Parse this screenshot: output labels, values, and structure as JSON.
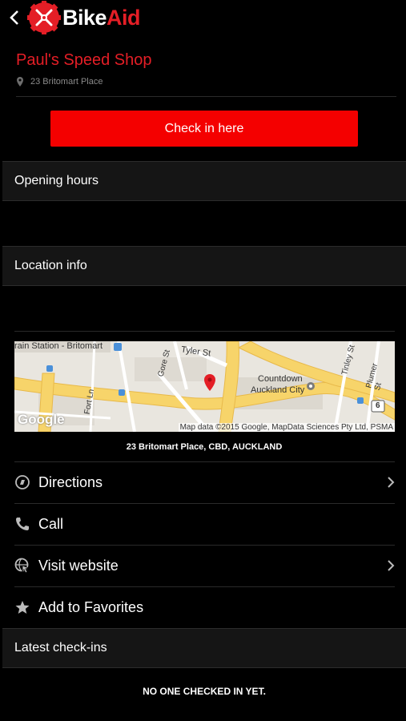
{
  "app": {
    "brand_part1": "Bike",
    "brand_part2": "Aid"
  },
  "shop": {
    "name": "Paul's Speed Shop",
    "address": "23 Britomart Place"
  },
  "checkin_button": "Check in here",
  "sections": {
    "opening_hours": "Opening hours",
    "location_info": "Location info",
    "latest_checkins": "Latest check-ins"
  },
  "map": {
    "labels": {
      "station": "rain Station - Britomart",
      "tyler": "Tyler St",
      "gore": "Gore St",
      "tinley": "Tinley St",
      "plumer": "Plumer St",
      "fort": "Fort Ln",
      "countdown1": "Countdown",
      "countdown2": "Auckland City",
      "route": "6",
      "google": "Google",
      "attribution": "Map data ©2015 Google, MapData Sciences Pty Ltd, PSMA"
    },
    "caption": "23 Britomart Place, CBD, AUCKLAND"
  },
  "actions": [
    {
      "label": "Directions",
      "icon": "compass-icon",
      "chevron": true
    },
    {
      "label": "Call",
      "icon": "phone-icon",
      "chevron": false
    },
    {
      "label": "Visit website",
      "icon": "globe-cursor-icon",
      "chevron": true
    },
    {
      "label": "Add to Favorites",
      "icon": "star-icon",
      "chevron": false
    }
  ],
  "checkins_empty": "NO ONE CHECKED IN YET.",
  "colors": {
    "brand_red": "#e41e26",
    "button_red": "#f40000",
    "background": "#000000",
    "section_bg": "#151515"
  }
}
